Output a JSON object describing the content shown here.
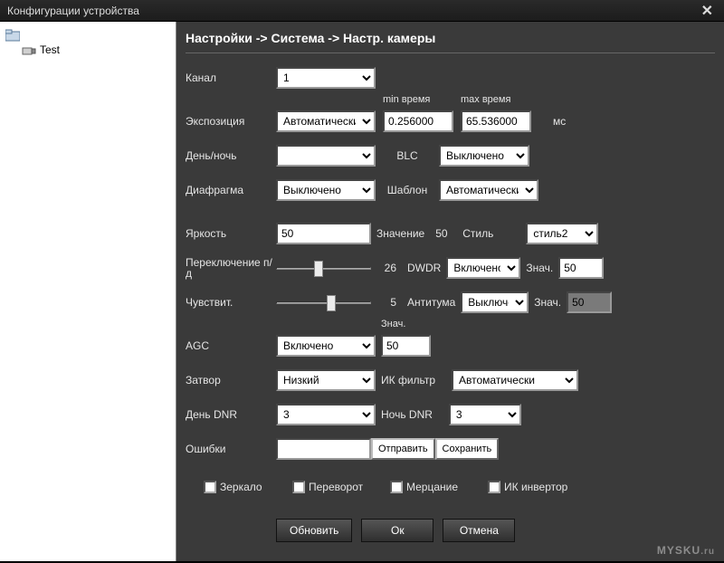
{
  "window": {
    "title": "Конфигурации устройства"
  },
  "tree": {
    "root": "",
    "item": "Test"
  },
  "breadcrumb": "Настройки -> Система -> Настр. камеры",
  "f": {
    "channel": {
      "label": "Канал",
      "value": "1"
    },
    "exposure": {
      "label": "Экспозиция",
      "value": "Автоматически",
      "min_hdr": "min время",
      "max_hdr": "max время",
      "min": "0.256000",
      "max": "65.536000",
      "unit": "мс"
    },
    "daynight": {
      "label": "День/ночь",
      "value": ""
    },
    "blc": {
      "label": "BLC",
      "value": "Выключено"
    },
    "aperture": {
      "label": "Диафрагма",
      "value": "Выключено"
    },
    "pattern": {
      "label": "Шаблон",
      "value": "Автоматически"
    },
    "brightness": {
      "label": "Яркость",
      "value": "50",
      "valhdr": "Значение",
      "valnum": "50"
    },
    "style": {
      "label": "Стиль",
      "value": "стиль2"
    },
    "switch": {
      "label": "Переключение п/д",
      "value": "26"
    },
    "dwdr": {
      "label": "DWDR",
      "value": "Включено",
      "vallabel": "Знач.",
      "valnum": "50"
    },
    "sens": {
      "label": "Чувствит.",
      "value": "5"
    },
    "antifog": {
      "label": "Антитума",
      "value": "Выключе",
      "vallabel": "Знач.",
      "valnum": "50"
    },
    "agc": {
      "label": "AGC",
      "value": "Включено",
      "valhdr": "Знач.",
      "valnum": "50"
    },
    "shutter": {
      "label": "Затвор",
      "value": "Низкий"
    },
    "irfilter": {
      "label": "ИК фильтр",
      "value": "Автоматически"
    },
    "daydnr": {
      "label": "День DNR",
      "value": "3"
    },
    "nightdnr": {
      "label": "Ночь DNR",
      "value": "3"
    },
    "errors": {
      "label": "Ошибки",
      "value": "",
      "send": "Отправить",
      "save": "Сохранить"
    },
    "mirror": "Зеркало",
    "flip": "Переворот",
    "flicker": "Мерцание",
    "irinvert": "ИК инвертор"
  },
  "buttons": {
    "refresh": "Обновить",
    "ok": "Ок",
    "cancel": "Отмена"
  },
  "watermark": {
    "main": "MYSKU",
    "sub": ".ru"
  }
}
